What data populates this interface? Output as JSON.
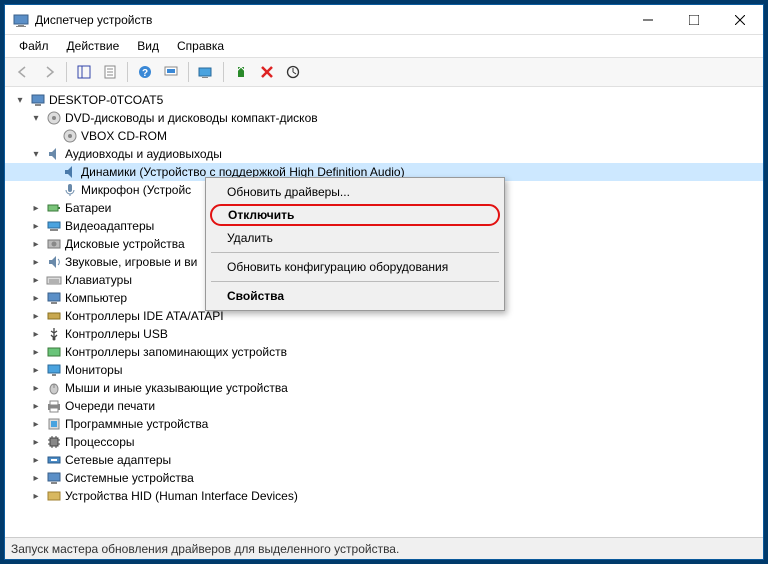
{
  "window": {
    "title": "Диспетчер устройств"
  },
  "menu": {
    "file": "Файл",
    "action": "Действие",
    "view": "Вид",
    "help": "Справка"
  },
  "tree": {
    "root": "DESKTOP-0TCOAT5",
    "dvd": "DVD-дисководы и дисководы компакт-дисков",
    "dvd_child": "VBOX CD-ROM",
    "audio": "Аудиовходы и аудиовыходы",
    "audio_speakers": "Динамики (Устройство с поддержкой High Definition Audio)",
    "audio_mic": "Микрофон (Устройс",
    "batteries": "Батареи",
    "video": "Видеоадаптеры",
    "disk": "Дисковые устройства",
    "sound": "Звуковые, игровые и ви",
    "keyboards": "Клавиатуры",
    "computer": "Компьютер",
    "ide": "Контроллеры IDE ATA/ATAPI",
    "usb": "Контроллеры USB",
    "storage": "Контроллеры запоминающих устройств",
    "monitors": "Мониторы",
    "mice": "Мыши и иные указывающие устройства",
    "print": "Очереди печати",
    "software": "Программные устройства",
    "cpu": "Процессоры",
    "network": "Сетевые адаптеры",
    "system": "Системные устройства",
    "hid": "Устройства HID (Human Interface Devices)"
  },
  "context": {
    "update": "Обновить драйверы...",
    "disable": "Отключить",
    "uninstall": "Удалить",
    "scan": "Обновить конфигурацию оборудования",
    "properties": "Свойства"
  },
  "status": "Запуск мастера обновления драйверов для выделенного устройства."
}
